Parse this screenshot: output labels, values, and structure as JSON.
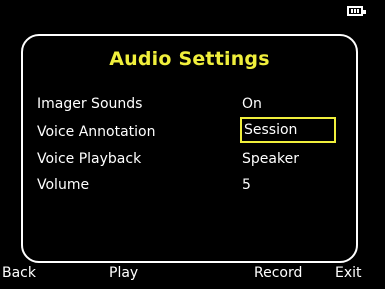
{
  "status_bar": {
    "battery_icon": "battery-icon",
    "battery_level": "3 of 4 bars"
  },
  "panel": {
    "title": "Audio Settings",
    "title_color": "#f0ef3c",
    "settings": [
      {
        "label": "Imager Sounds",
        "value": "On"
      },
      {
        "label": "Voice Annotation",
        "value": "Session",
        "selected": true
      },
      {
        "label": "Voice Playback",
        "value": "Speaker"
      },
      {
        "label": "Volume",
        "value": "5"
      }
    ]
  },
  "softkeys": {
    "back": "Back",
    "play": "Play",
    "record": "Record",
    "exit": "Exit"
  },
  "colors": {
    "background": "#000000",
    "text": "#ffffff",
    "accent": "#f0ef3c"
  }
}
